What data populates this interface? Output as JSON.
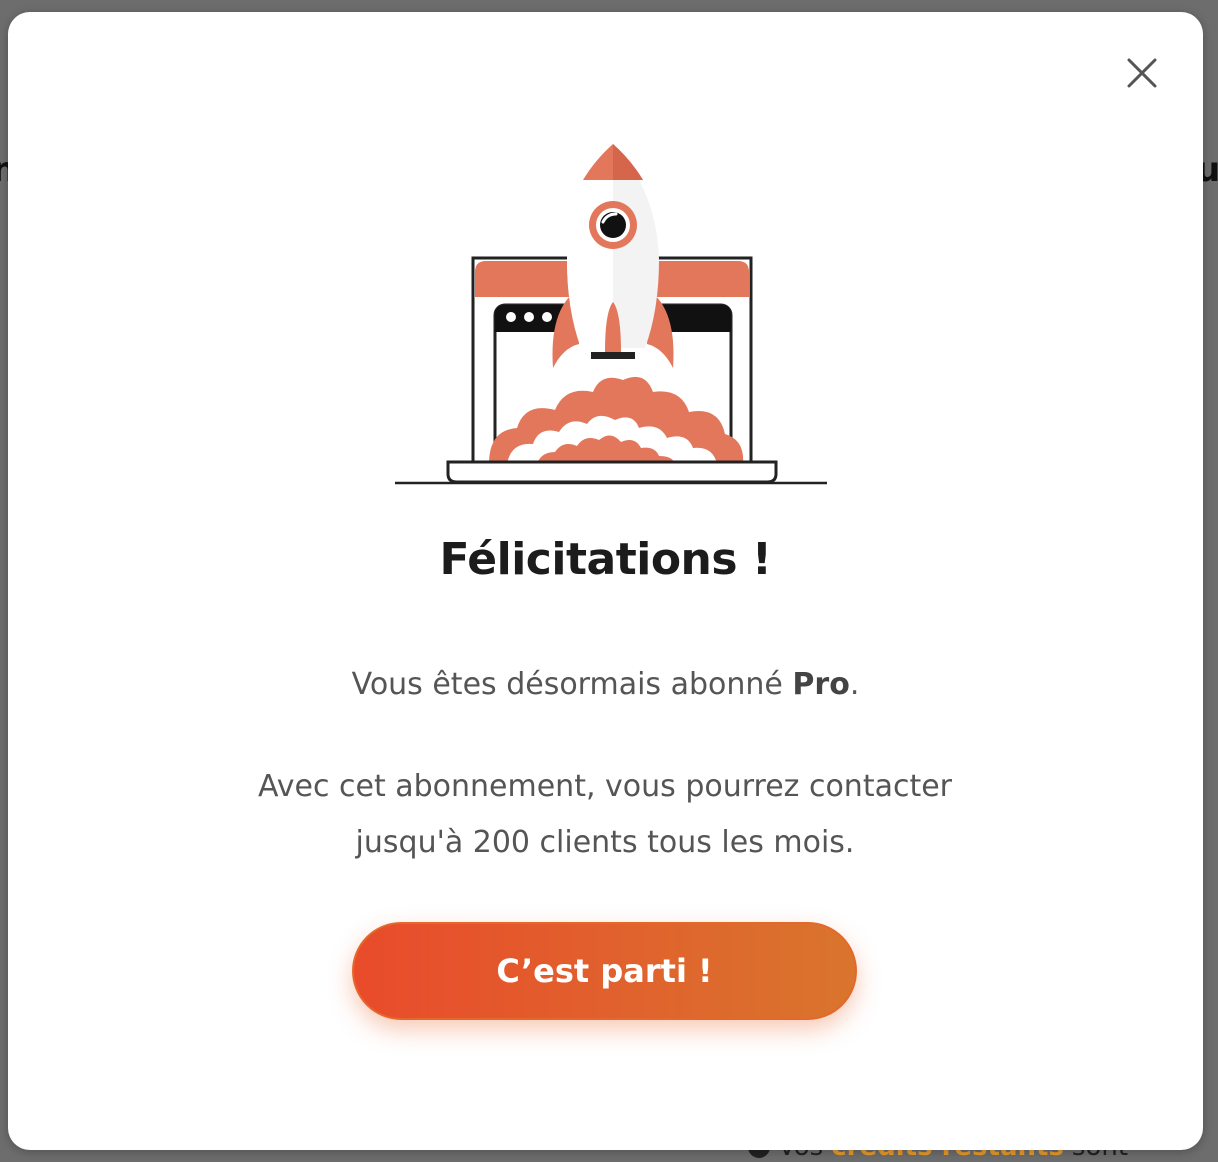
{
  "modal": {
    "title": "Félicitations !",
    "subscription_prefix": "Vous êtes désormais abonné ",
    "plan_name": "Pro",
    "subscription_suffix": ".",
    "description": "Avec cet abonnement, vous pourrez contacter jusqu'à 200 clients tous les mois.",
    "cta_label": "C’est parti !",
    "close_icon": "close-icon",
    "illustration_icon": "rocket-launch-laptop-icon"
  },
  "background": {
    "peek_text_prefix": "Vos ",
    "peek_text_accent": "crédits restants",
    "peek_text_suffix": " sont"
  },
  "colors": {
    "accent": "#e0622d",
    "rocket_orange": "#e2775c",
    "title_text": "#1c1c1c",
    "body_text": "#555555"
  }
}
